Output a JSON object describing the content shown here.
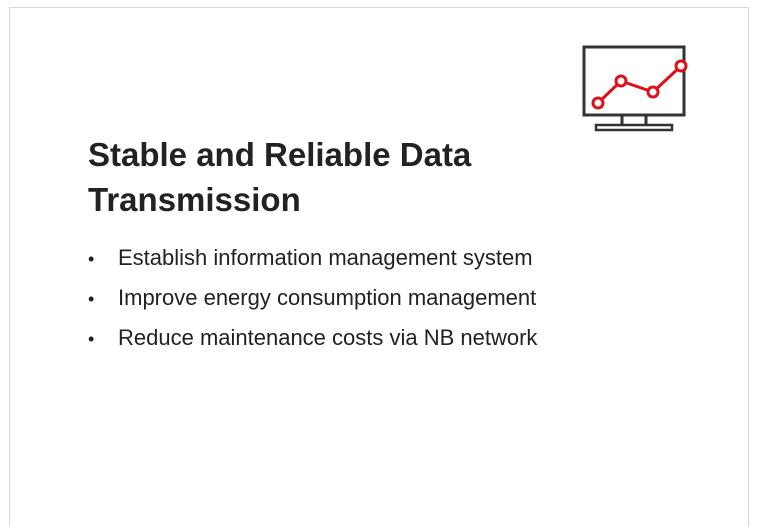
{
  "icon": {
    "name": "monitor-line-chart-icon",
    "stroke_color": "#333333",
    "accent_color": "#e0101b"
  },
  "title": "Stable and Reliable Data Transmission",
  "bullet_glyph": "•",
  "bullets": [
    "Establish information management system",
    "Improve energy consumption management",
    "Reduce maintenance costs via NB network"
  ]
}
